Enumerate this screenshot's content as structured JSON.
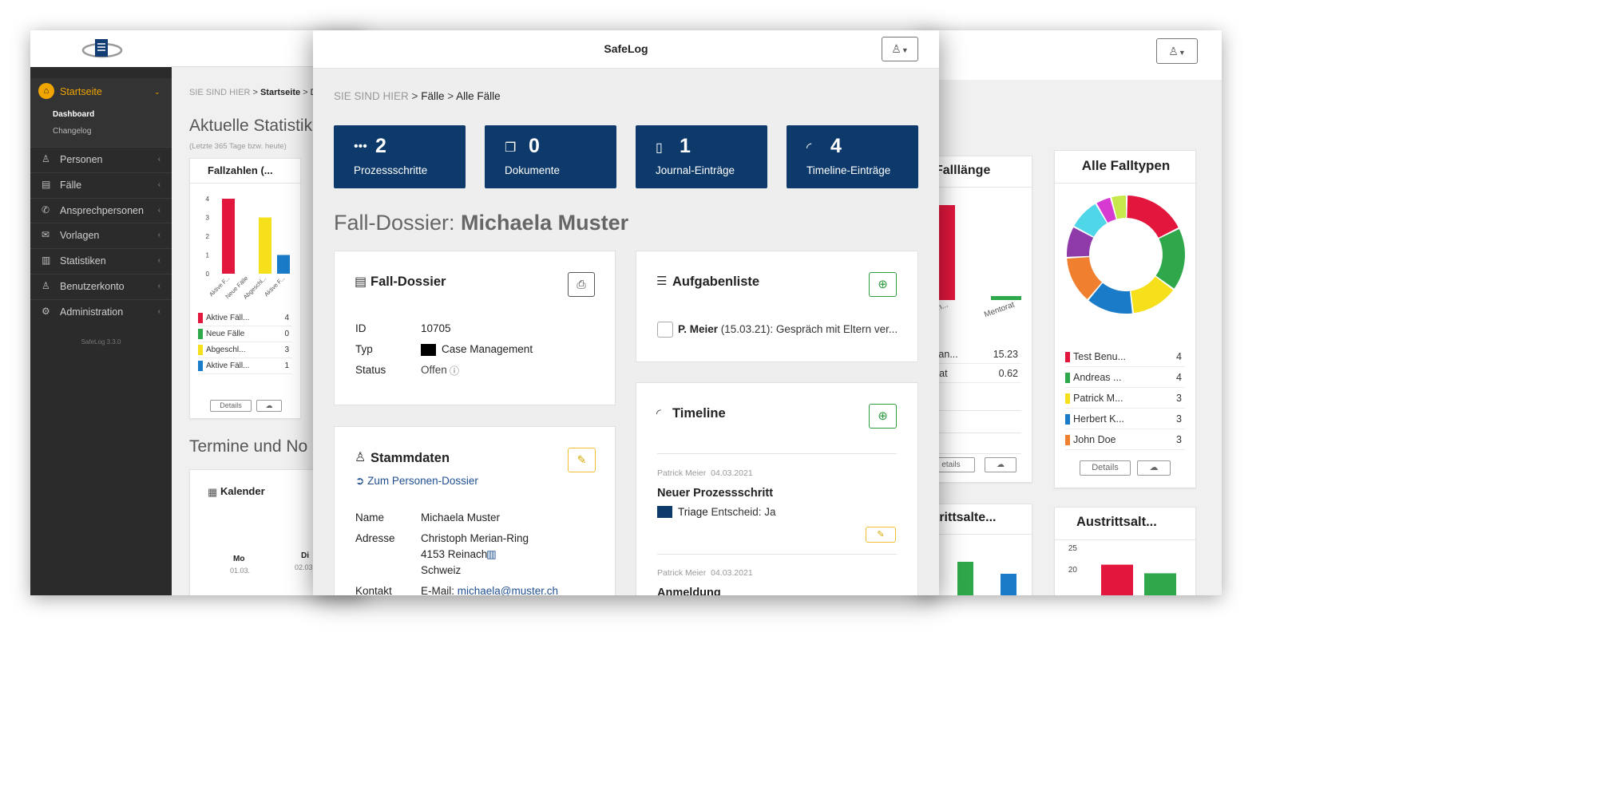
{
  "left": {
    "sidebar": {
      "active": {
        "label": "Startseite",
        "sub": [
          "Dashboard",
          "Changelog"
        ]
      },
      "items": [
        {
          "icon": "user-icon",
          "label": "Personen"
        },
        {
          "icon": "book-icon",
          "label": "Fälle"
        },
        {
          "icon": "phone-icon",
          "label": "Ansprechpersonen"
        },
        {
          "icon": "envelope-icon",
          "label": "Vorlagen"
        },
        {
          "icon": "bar-chart-icon",
          "label": "Statistiken"
        },
        {
          "icon": "user-icon",
          "label": "Benutzerkonto"
        },
        {
          "icon": "gear-icon",
          "label": "Administration"
        }
      ],
      "version": "SafeLog 3.3.0"
    },
    "breadcrumb": {
      "prefix": "SIE SIND HIER",
      "item1": "Startseite",
      "item2": "D"
    },
    "heading": "Aktuelle Statistik",
    "subheading": "(Letzte 365 Tage bzw. heute)",
    "chart_card": {
      "title": "Fallzahlen (...",
      "details": "Details"
    },
    "section2": "Termine und No",
    "calendar": {
      "title": "Kalender",
      "days": [
        {
          "name": "Mo",
          "date": "01.03."
        },
        {
          "name": "Di",
          "date": "02.03"
        }
      ]
    }
  },
  "main": {
    "app_title": "SafeLog",
    "breadcrumb": {
      "prefix": "SIE SIND HIER",
      "item1": "Fälle",
      "item2": "Alle Fälle"
    },
    "stats": [
      {
        "icon": "dots-icon",
        "value": "2",
        "label": "Prozessschritte"
      },
      {
        "icon": "documents-icon",
        "value": "0",
        "label": "Dokumente"
      },
      {
        "icon": "journal-icon",
        "value": "1",
        "label": "Journal-Einträge"
      },
      {
        "icon": "rss-icon",
        "value": "4",
        "label": "Timeline-Einträge"
      }
    ],
    "heading_prefix": "Fall-Dossier: ",
    "heading_name": "Michaela Muster",
    "dossier": {
      "title": "Fall-Dossier",
      "id_label": "ID",
      "id_value": "10705",
      "type_label": "Typ",
      "type_value": "Case Management",
      "type_color": "#000000",
      "status_label": "Status",
      "status_value": "Offen"
    },
    "stammdaten": {
      "title": "Stammdaten",
      "link": "Zum Personen-Dossier",
      "name_label": "Name",
      "name_value": "Michaela Muster",
      "address_label": "Adresse",
      "address_line1": "Christoph Merian-Ring",
      "address_line2": "4153 Reinach",
      "address_line3": "Schweiz",
      "contact_label": "Kontakt",
      "contact_prefix": "E-Mail: ",
      "contact_email": "michaela@muster.ch"
    },
    "tasks": {
      "title": "Aufgabenliste",
      "item_person": "P. Meier",
      "item_text": " (15.03.21): Gespräch mit Eltern ver..."
    },
    "timeline": {
      "title": "Timeline",
      "entries": [
        {
          "author": "Patrick Meier",
          "date": "04.03.2021",
          "title": "Neuer Prozessschritt",
          "tag": "Triage",
          "tag_color": "#0d3a6a",
          "detail": " Entscheid: Ja"
        },
        {
          "author": "Patrick Meier",
          "date": "04.03.2021",
          "title": "Anmeldung"
        }
      ]
    }
  },
  "right": {
    "card1": {
      "title": "Falllänge"
    },
    "card2": {
      "title": "Alle Falltypen",
      "details": "Details"
    },
    "card3": {
      "title": "trittsalte..."
    },
    "card4": {
      "title": "Austrittsalt..."
    }
  },
  "chart_data": [
    {
      "type": "bar",
      "title": "Fallzahlen (...",
      "categories": [
        "Aktive F...",
        "Neue Fälle",
        "Abgeschl...",
        "Aktive F..."
      ],
      "values": [
        4,
        0,
        3,
        1
      ],
      "colors": [
        "#e3173e",
        "#2ea84a",
        "#f5e01b",
        "#1a7bc8"
      ],
      "ylim": [
        0,
        4
      ],
      "yticks": [
        "0",
        "1",
        "2",
        "3",
        "4"
      ],
      "legend": [
        {
          "label": "Aktive Fäll...",
          "value": "4"
        },
        {
          "label": "Neue Fälle",
          "value": "0"
        },
        {
          "label": "Abgeschl...",
          "value": "3"
        },
        {
          "label": "Aktive Fäll...",
          "value": "1"
        }
      ]
    },
    {
      "type": "bar",
      "title": "Falllänge",
      "categories": [
        "...Man...",
        "Mentorat"
      ],
      "values": [
        15.23,
        0.62
      ],
      "colors": [
        "#e3173e",
        "#2ea84a"
      ],
      "legend": [
        {
          "label": "Man...",
          "value": "15.23"
        },
        {
          "label": "orat",
          "value": "0.62"
        }
      ]
    },
    {
      "type": "pie",
      "title": "Alle Falltypen",
      "values": [
        4,
        4,
        3,
        3,
        3,
        2,
        2,
        1,
        1
      ],
      "colors": [
        "#e3173e",
        "#2ea84a",
        "#f5e01b",
        "#1a7bc8",
        "#f08030",
        "#8e3aa8",
        "#4fd6e8",
        "#d63ad0",
        "#c6e84a"
      ],
      "legend": [
        {
          "label": "Test Benu...",
          "value": "4"
        },
        {
          "label": "Andreas ...",
          "value": "4"
        },
        {
          "label": "Patrick M...",
          "value": "3"
        },
        {
          "label": "Herbert K...",
          "value": "3"
        },
        {
          "label": "John Doe",
          "value": "3"
        }
      ]
    },
    {
      "type": "bar",
      "title": "Austrittsalt...",
      "yticks": [
        "20",
        "25"
      ],
      "values": [
        21,
        19
      ],
      "colors": [
        "#e3173e",
        "#2ea84a"
      ]
    }
  ]
}
